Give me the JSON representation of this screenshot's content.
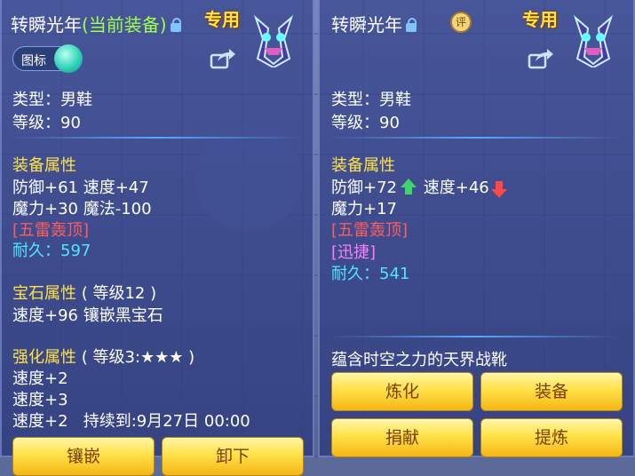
{
  "left": {
    "title": "转瞬光年",
    "current": "(当前装备)",
    "special": "专用",
    "toggle_label": "图标",
    "type": "类型：男鞋",
    "level": "等级：90",
    "attr_header": "装备属性",
    "attr1": "防御+61 速度+47",
    "attr2": "魔力+30 魔法-100",
    "skill": "[五雷轰顶]",
    "durability_label": "耐久：",
    "durability_value": "597",
    "gem_header": "宝石属性",
    "gem_level": "( 等级12 )",
    "gem_line": "速度+96 镶嵌黑宝石",
    "enhance_header": "强化属性",
    "enhance_level": "( 等级3:★★★ )",
    "enh1": "速度+2",
    "enh2": "速度+3",
    "enh3": "速度+2",
    "enh3_extra": "持续到:9月27日 00:00",
    "btn_inlay": "镶嵌",
    "btn_unequip": "卸下"
  },
  "right": {
    "title": "转瞬光年",
    "rate_icon": "评",
    "special": "专用",
    "type": "类型：男鞋",
    "level": "等级：90",
    "attr_header": "装备属性",
    "def": "防御+72",
    "spd": "速度+46",
    "attr2": "魔力+17",
    "skill1": "[五雷轰顶]",
    "skill2": "[迅捷]",
    "durability_label": "耐久：",
    "durability_value": "541",
    "desc": "蕴含时空之力的天界战靴",
    "btn_refine": "炼化",
    "btn_equip": "装备",
    "btn_donate": "捐献",
    "btn_extract": "提炼"
  },
  "colors": {
    "accent": "#ffe246",
    "cyan": "#4ee6ff",
    "skill": "#ff5c5c",
    "green": "#9dff4e"
  },
  "icons": [
    "lock-icon",
    "share-icon",
    "pet-avatar-icon",
    "rate-icon",
    "arrow-up-icon",
    "arrow-down-icon"
  ]
}
